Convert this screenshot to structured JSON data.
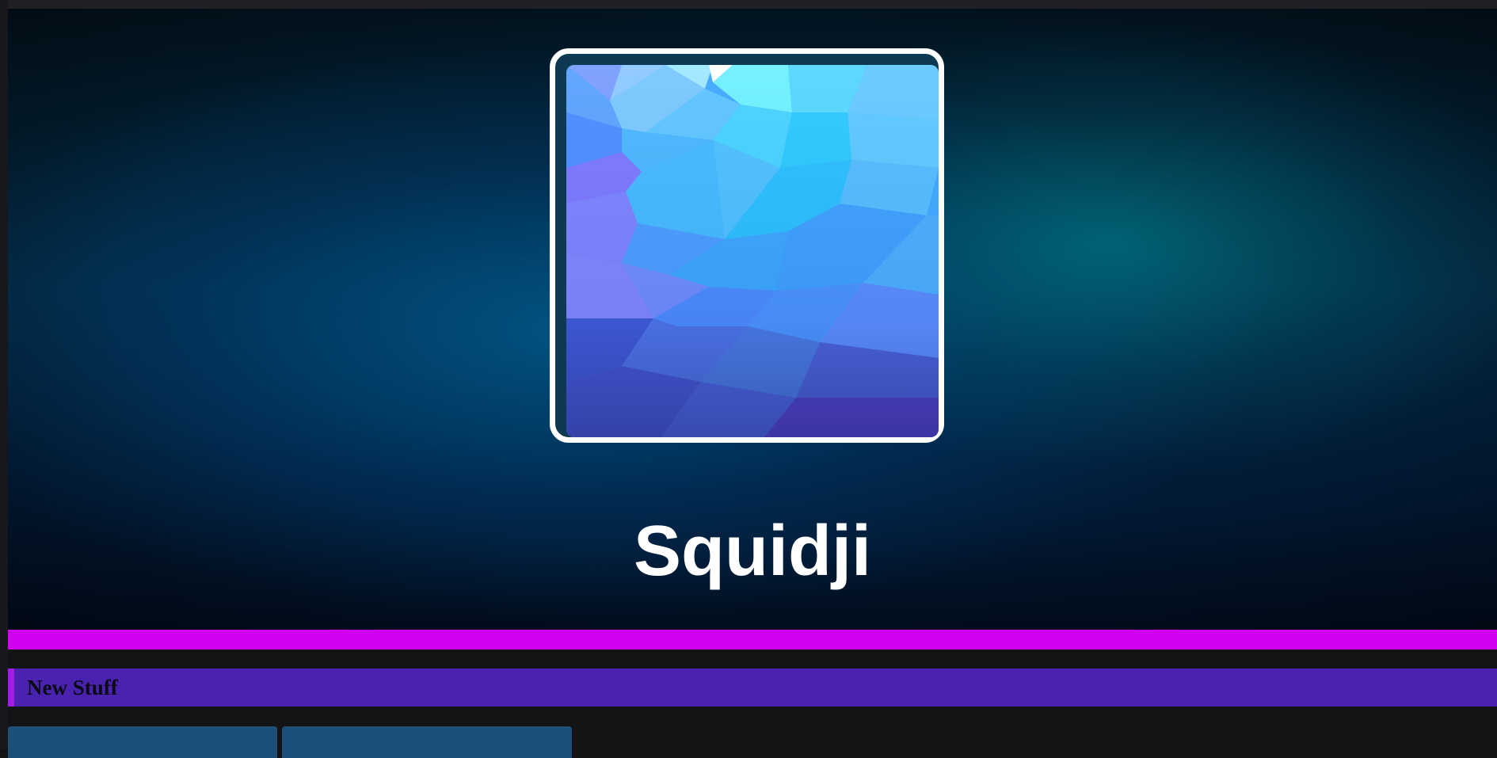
{
  "profile": {
    "name": "Squidji",
    "avatar_alt": "low-poly blue crystal avatar"
  },
  "sections": [
    {
      "title": "New Stuff"
    }
  ],
  "colors": {
    "accent_bar": "#d000f0",
    "section_header": "#4a22b0",
    "section_header_edge": "#a21be6",
    "card": "#1d5079",
    "page_background": "#141417"
  }
}
